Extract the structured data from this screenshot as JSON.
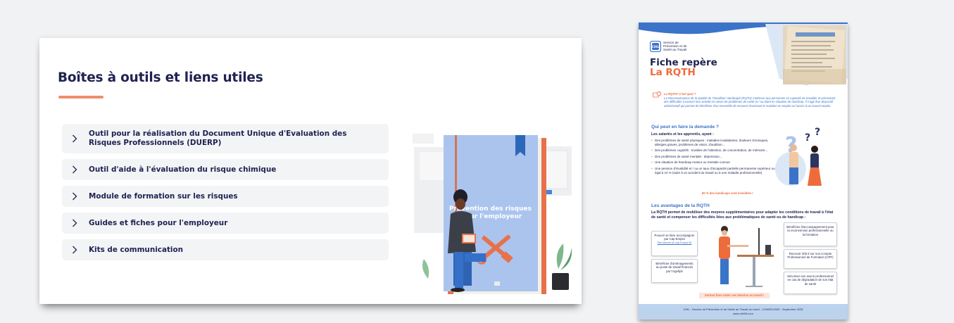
{
  "slide": {
    "title": "Boîtes à outils et liens utiles",
    "menu_items": [
      {
        "label": "Outil pour la réalisation du Document Unique d'Evaluation des Risques Professionnels (DUERP)"
      },
      {
        "label": "Outil d'aide à l'évaluation du risque chimique"
      },
      {
        "label": "Module de formation sur les risques"
      },
      {
        "label": "Guides et fiches pour l'employeur"
      },
      {
        "label": "Kits de communication"
      }
    ],
    "illustration_book_text": "Prévention des risques pour l'employeur",
    "colors": {
      "navy": "#1f2251",
      "accent": "#ee8f6c",
      "item_bg": "#f3f4f6",
      "book": "#a9c3ee"
    }
  },
  "poster": {
    "logo_text": "Service de Prévention et de Santé au Travail",
    "logo_mark": "CIHL",
    "title_line1": "Fiche repère",
    "title_line2": "La RQTH",
    "intro_title": "La RQTH? C'est quoi ?",
    "intro_text": "La Reconnaissance de la Qualité de Travailleur Handicapé (RQTH) s'adresse aux personnes en capacité de travailler et présentant des difficultés à exercer leur activité en raison de problèmes de santé et / ou étant en situation de handicap. Il s'agit d'un dispositif administratif qui permet de bénéficier d'un ensemble de mesures favorisant le maintien en emploi ou l'accès à un nouvel emploi.",
    "section1_title": "Qui peut en faire la demande ?",
    "section1_lead": "Les salariés et les apprentis, ayant :",
    "section1_bullets": [
      "Des problèmes de santé physiques : maladies invalidantes, douleurs chroniques, allergies graves, problèmes de vision, d'audition...",
      "Des problèmes cognitifs : troubles de l'attention, de concentration, de mémoire...",
      "Des problèmes de santé mentale : dépression...",
      "Une situation de handicap moteur ou mentale connue",
      "Une pension d'invalidité et / ou un taux d'incapacité partielle permanente supérieur ou égal à 10 % (suite à un accident du travail ou à une maladie professionnelle)"
    ],
    "section1_highlight": "80 % des handicaps sont invisibles !",
    "section2_title": "Les avantages de la RQTH",
    "section2_lead": "La RQTH permet de mobiliser des moyens supplémentaires pour adapter les conditions de travail à l'état de santé et compenser les difficultés liées aux problématiques de santé ou de handicap :",
    "advantages": [
      "Pouvoir se faire accompagner par Cap Emploi",
      "Bénéficier d'accompagnement pour la reconversion professionnelle ou la formation",
      "Recevoir 300 € sur son Compte Professionnel de Formation (CPF)",
      "Bénéficier d'aménagements au poste de travail financés par l'Agefiph",
      "Sécuriser son avenir professionnel en cas de dégradation de son état de santé"
    ],
    "cap_emploi_link": "Site internet du Cap Emploi 45",
    "cta": "Surtout faire valoir ses besoins au travail !",
    "footer_line1": "CIHL - Service de Prévention et de Santé au Travail du Loiret - COM/SCI/025 - Septembre 2025",
    "footer_line2": "www.cihl45.com",
    "colors": {
      "navy": "#1f2251",
      "orange": "#ee6b3c",
      "blue": "#3b73c8",
      "footer": "#bcd3ee"
    }
  }
}
